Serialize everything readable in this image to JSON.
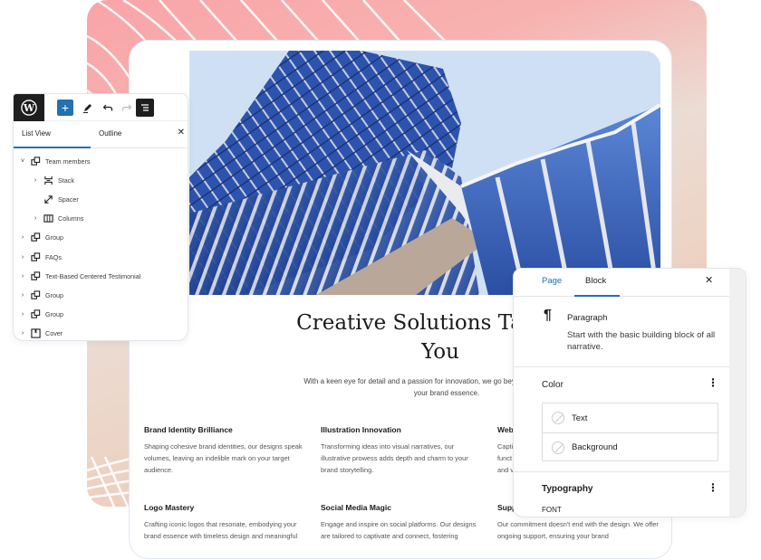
{
  "list_view": {
    "toolbar": {
      "logo": "wordpress-logo",
      "add_label": "+",
      "edit_icon": "pencil-icon",
      "undo_icon": "undo-icon",
      "redo_icon": "redo-icon",
      "list_icon": "list-view-icon"
    },
    "tabs": [
      {
        "label": "List View",
        "active": true
      },
      {
        "label": "Outline",
        "active": false
      }
    ],
    "close_label": "✕",
    "items": [
      {
        "label": "Team members",
        "icon": "group-icon",
        "chevron": "˅",
        "level": 0
      },
      {
        "label": "Stack",
        "icon": "stack-icon",
        "chevron": "›",
        "level": 1
      },
      {
        "label": "Spacer",
        "icon": "spacer-icon",
        "chevron": "",
        "level": 1
      },
      {
        "label": "Columns",
        "icon": "columns-icon",
        "chevron": "›",
        "level": 1
      },
      {
        "label": "Group",
        "icon": "group-icon",
        "chevron": "›",
        "level": 0
      },
      {
        "label": "FAQs",
        "icon": "group-icon",
        "chevron": "›",
        "level": 0
      },
      {
        "label": "Text-Based Centered Testimonial",
        "icon": "group-icon",
        "chevron": "›",
        "level": 0
      },
      {
        "label": "Group",
        "icon": "group-icon",
        "chevron": "›",
        "level": 0
      },
      {
        "label": "Group",
        "icon": "group-icon",
        "chevron": "›",
        "level": 0
      },
      {
        "label": "Cover",
        "icon": "cover-icon",
        "chevron": "›",
        "level": 0
      }
    ]
  },
  "page": {
    "headline_line1": "Creative Solutions Tailored",
    "headline_line2": "You",
    "lead_line1": "With a keen eye for detail and a passion for innovation, we go beyond aesthetics to delve",
    "lead_line2": "your brand essence.",
    "features": [
      {
        "title": "Brand Identity Brilliance",
        "text": "Shaping cohesive brand identities, our designs speak volumes, leaving an indelible mark on your target audience."
      },
      {
        "title": "Illustration Innovation",
        "text": "Transforming ideas into visual narratives, our illustrative prowess adds depth and charm to your brand storytelling."
      },
      {
        "title": "Web",
        "text": "Capti funct and v"
      },
      {
        "title": "Logo Mastery",
        "text": "Crafting iconic logos that resonate, embodying your brand essence with timeless design and meaningful"
      },
      {
        "title": "Social Media Magic",
        "text": "Engage and inspire on social platforms. Our designs are tailored to captivate and connect, fostering"
      },
      {
        "title": "Supp",
        "text": "Our commitment doesn't end with the design. We offer ongoing support, ensuring your brand"
      }
    ]
  },
  "inspector": {
    "tabs": [
      {
        "label": "Page",
        "active": false
      },
      {
        "label": "Block",
        "active": true
      }
    ],
    "close_label": "✕",
    "block": {
      "icon": "paragraph-icon",
      "glyph": "¶",
      "title": "Paragraph",
      "description": "Start with the basic building block of all narrative."
    },
    "color": {
      "title": "Color",
      "more": "⋮",
      "items": [
        {
          "label": "Text"
        },
        {
          "label": "Background"
        }
      ]
    },
    "typography": {
      "title": "Typography",
      "more": "⋮",
      "font_label": "FONT"
    }
  },
  "colors": {
    "accent": "#2271b1",
    "dark": "#1e1e1e",
    "bg_pink": "#f9a4a8",
    "bg_peach": "#f1b9a0"
  }
}
